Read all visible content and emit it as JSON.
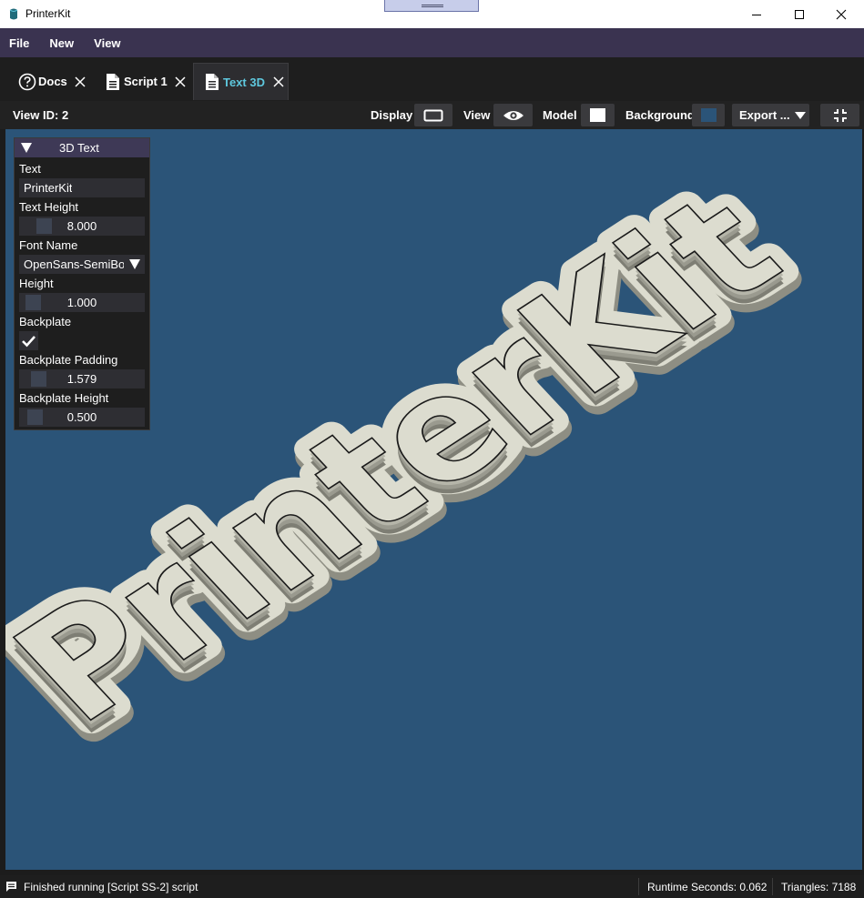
{
  "window": {
    "title": "PrinterKit"
  },
  "menu": {
    "items": [
      "File",
      "New",
      "View"
    ]
  },
  "tabs": [
    {
      "label": "Docs",
      "icon": "help-circle-icon"
    },
    {
      "label": "Script 1",
      "icon": "file-icon"
    },
    {
      "label": "Text 3D",
      "icon": "file-icon",
      "active": true
    }
  ],
  "toolbar": {
    "view_id": "View ID: 2",
    "display_label": "Display",
    "view_label": "View",
    "model_label": "Model",
    "background_label": "Background",
    "export_label": "Export ...",
    "model_color": "#ffffff",
    "background_color": "#2b5478"
  },
  "panel": {
    "title": "3D Text",
    "text_label": "Text",
    "text_value": "PrinterKit",
    "text_height_label": "Text Height",
    "text_height_value": "8.000",
    "font_name_label": "Font Name",
    "font_name_value": "OpenSans-SemiBold",
    "height_label": "Height",
    "height_value": "1.000",
    "backplate_label": "Backplate",
    "backplate_checked": true,
    "backplate_padding_label": "Backplate Padding",
    "backplate_padding_value": "1.579",
    "backplate_height_label": "Backplate Height",
    "backplate_height_value": "0.500"
  },
  "scene": {
    "model_text": "PrinterKit",
    "model_color": "#dcdccf",
    "background_color": "#2b5478"
  },
  "status": {
    "message": "Finished running [Script SS-2] script",
    "runtime": "Runtime Seconds: 0.062",
    "triangles": "Triangles: 7188"
  }
}
